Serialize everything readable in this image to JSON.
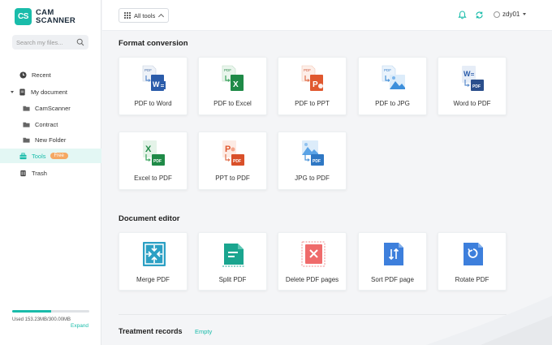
{
  "app": {
    "logo_mark": "CS",
    "logo_line1": "CAM",
    "logo_line2": "SCANNER",
    "brand_color": "#19bcaa"
  },
  "sidebar": {
    "search_placeholder": "Search my files...",
    "items": [
      {
        "label": "Recent",
        "icon": "clock-icon"
      },
      {
        "label": "My document",
        "icon": "document-icon"
      },
      {
        "label": "CamScanner",
        "icon": "folder-icon"
      },
      {
        "label": "Contract",
        "icon": "folder-icon"
      },
      {
        "label": "New Folder",
        "icon": "folder-icon"
      },
      {
        "label": "Tools",
        "icon": "toolbox-icon",
        "badge": "Free",
        "active": true
      },
      {
        "label": "Trash",
        "icon": "trash-icon"
      }
    ],
    "storage": {
      "text": "Used 153.23MB/300.00MB",
      "used_fraction": 0.51,
      "expand_label": "Expand"
    }
  },
  "header": {
    "all_tools_label": "All tools",
    "icons": [
      "bell-icon",
      "sync-icon"
    ],
    "username": "zdy01"
  },
  "format_conversion": {
    "title": "Format conversion",
    "tools": [
      {
        "label": "PDF to Word",
        "icon": "pdf-to-word-icon"
      },
      {
        "label": "PDF to Excel",
        "icon": "pdf-to-excel-icon"
      },
      {
        "label": "PDF to PPT",
        "icon": "pdf-to-ppt-icon"
      },
      {
        "label": "PDF to JPG",
        "icon": "pdf-to-jpg-icon"
      },
      {
        "label": "Word to PDF",
        "icon": "word-to-pdf-icon"
      },
      {
        "label": "Excel to PDF",
        "icon": "excel-to-pdf-icon"
      },
      {
        "label": "PPT to PDF",
        "icon": "ppt-to-pdf-icon"
      },
      {
        "label": "JPG to PDF",
        "icon": "jpg-to-pdf-icon"
      }
    ]
  },
  "document_editor": {
    "title": "Document editor",
    "tools": [
      {
        "label": "Merge PDF",
        "icon": "merge-pdf-icon"
      },
      {
        "label": "Split PDF",
        "icon": "split-pdf-icon"
      },
      {
        "label": "Delete PDF pages",
        "icon": "delete-pages-icon"
      },
      {
        "label": "Sort PDF page",
        "icon": "sort-pages-icon"
      },
      {
        "label": "Rotate PDF",
        "icon": "rotate-pdf-icon"
      }
    ]
  },
  "records": {
    "title": "Treatment records",
    "empty_label": "Empty"
  }
}
